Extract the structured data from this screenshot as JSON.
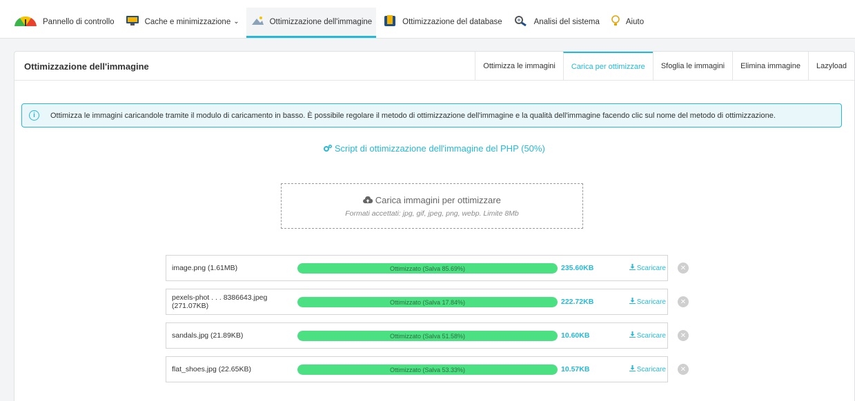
{
  "nav": {
    "items": [
      {
        "label": "Pannello di controllo",
        "icon": "dashboard-gauge-icon"
      },
      {
        "label": "Cache e minimizzazione",
        "icon": "monitor-icon",
        "dropdown": true
      },
      {
        "label": "Ottimizzazione dell'immagine",
        "icon": "image-icon",
        "active": true
      },
      {
        "label": "Ottimizzazione del database",
        "icon": "database-icon"
      },
      {
        "label": "Analisi del sistema",
        "icon": "system-analysis-icon"
      },
      {
        "label": "Aiuto",
        "icon": "help-bulb-icon"
      }
    ],
    "chevron": "⌄"
  },
  "panel": {
    "title": "Ottimizzazione dell'immagine",
    "tabs": [
      {
        "label": "Ottimizza le immagini"
      },
      {
        "label": "Carica per ottimizzare",
        "active": true
      },
      {
        "label": "Sfoglia le immagini"
      },
      {
        "label": "Elimina immagine"
      },
      {
        "label": "Lazyload"
      }
    ]
  },
  "info": {
    "icon_glyph": "i",
    "text": "Ottimizza le immagini caricandole tramite il modulo di caricamento in basso. È possibile regolare il metodo di ottimizzazione dell'immagine e la qualità dell'immagine facendo clic sul nome del metodo di ottimizzazione."
  },
  "script_link": "Script di ottimizzazione dell'immagine del PHP (50%)",
  "upload": {
    "title": "Carica immagini per ottimizzare",
    "subtitle": "Formati accettati: jpg, gif, jpeg, png, webp. Limite 8Mb"
  },
  "files": [
    {
      "name": "image.png (1.61MB)",
      "progress": 100,
      "status": "Ottimizzato (Salva 85.69%)",
      "size": "235.60KB",
      "download": "Scaricare"
    },
    {
      "name": "pexels-phot . . . 8386643.jpeg (271.07KB)",
      "progress": 100,
      "status": "Ottimizzato (Salva 17.84%)",
      "size": "222.72KB",
      "download": "Scaricare"
    },
    {
      "name": "sandals.jpg (21.89KB)",
      "progress": 100,
      "status": "Ottimizzato (Salva 51.58%)",
      "size": "10.60KB",
      "download": "Scaricare"
    },
    {
      "name": "flat_shoes.jpg (22.65KB)",
      "progress": 100,
      "status": "Ottimizzato (Salva 53.33%)",
      "size": "10.57KB",
      "download": "Scaricare"
    }
  ],
  "colors": {
    "accent": "#25b9d7",
    "progress": "#4be081",
    "info_bg": "#e9f7fb"
  }
}
